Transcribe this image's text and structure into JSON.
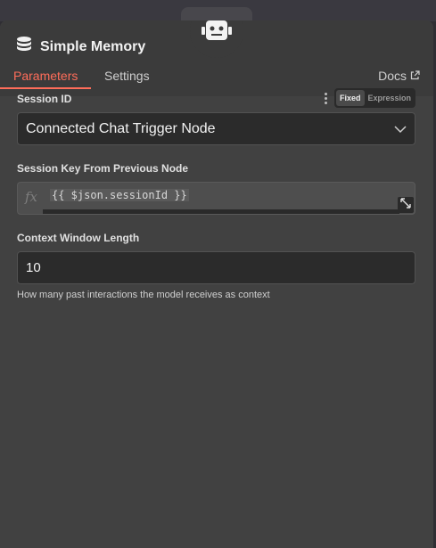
{
  "node": {
    "title": "Simple Memory",
    "icon": "database-icon",
    "top_icon": "robot-icon"
  },
  "tabs": {
    "parameters": "Parameters",
    "settings": "Settings",
    "docs": "Docs"
  },
  "session_id": {
    "label": "Session ID",
    "mode_fixed": "Fixed",
    "mode_expression": "Expression",
    "value": "Connected Chat Trigger Node"
  },
  "session_key": {
    "label": "Session Key From Previous Node",
    "fx": "fx",
    "expression": "{{ $json.sessionId }}"
  },
  "context_window": {
    "label": "Context Window Length",
    "value": "10",
    "hint": "How many past interactions the model receives as context"
  },
  "colors": {
    "accent": "#ff6d5a",
    "panel": "#414141",
    "header": "#3b3b3b"
  }
}
